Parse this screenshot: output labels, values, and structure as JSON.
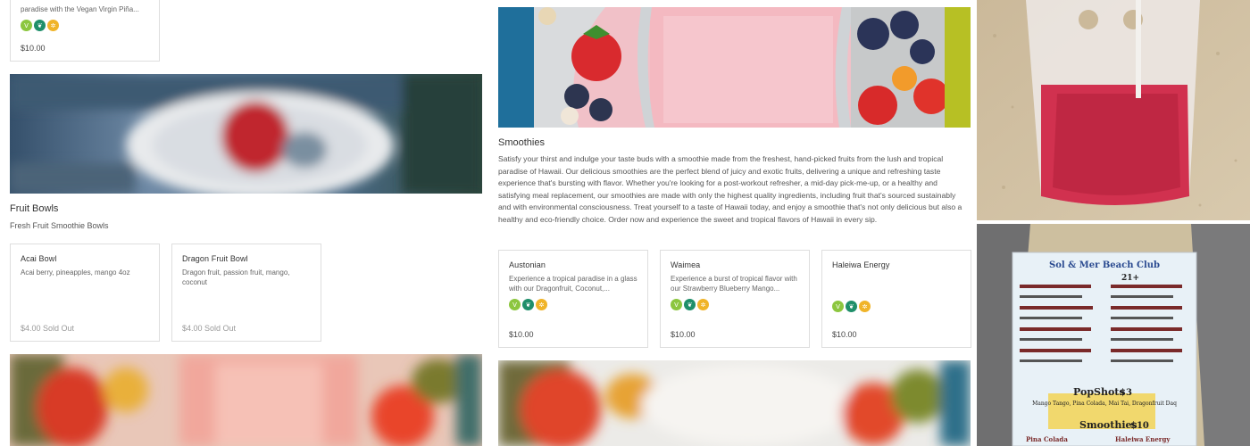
{
  "top_card": {
    "desc": "paradise with the Vegan Virgin Piña...",
    "price": "$10.00"
  },
  "fruit_bowls": {
    "title": "Fruit Bowls",
    "subtitle": "Fresh Fruit Smoothie Bowls",
    "items": [
      {
        "name": "Acai Bowl",
        "desc": "Acai berry, pineapples, mango 4oz",
        "price": "$4.00 Sold Out"
      },
      {
        "name": "Dragon Fruit Bowl",
        "desc": "Dragon fruit, passion fruit, mango, coconut",
        "price": "$4.00 Sold Out"
      }
    ]
  },
  "smoothies": {
    "title": "Smoothies",
    "description": "Satisfy your thirst and indulge your taste buds with a smoothie made from the freshest, hand-picked fruits from the lush and tropical paradise of Hawaii. Our delicious smoothies are the perfect blend of juicy and exotic fruits, delivering a unique and refreshing taste experience that's bursting with flavor. Whether you're looking for a post-workout refresher, a mid-day pick-me-up, or a healthy and satisfying meal replacement, our smoothies are made with only the highest quality ingredients, including fruit that's sourced sustainably and with environmental consciousness. Treat yourself to a taste of Hawaii today, and enjoy a smoothie that's not only delicious but also a healthy and eco-friendly choice. Order now and experience the sweet and tropical flavors of Hawaii in every sip.",
    "items": [
      {
        "name": "Austonian",
        "desc": "Experience a tropical paradise in a glass with our Dragonfruit, Coconut,...",
        "price": "$10.00"
      },
      {
        "name": "Waimea",
        "desc": "Experience a burst of tropical flavor with our Strawberry Blueberry Mango...",
        "price": "$10.00"
      },
      {
        "name": "Haleiwa Energy",
        "desc": "",
        "price": "$10.00"
      }
    ]
  },
  "badge_icons": [
    "vegan-icon",
    "leaf-icon",
    "gluten-free-icon"
  ],
  "badge_glyphs": {
    "vegan": "V",
    "leaf": "❦",
    "gf": "✲"
  },
  "menu_sign": {
    "title": "Sol & Mer Beach Club",
    "age": "21+",
    "section1": "PopShots",
    "section1_price": "$3",
    "section1_items": "Mango Tango, Pina Colada, Mai Tai, Dragonfruit Daq",
    "section2": "Smoothies",
    "section2_price": "$10",
    "section2_col1": "Pina Colada",
    "section2_col2": "Haleiwa Energy"
  }
}
